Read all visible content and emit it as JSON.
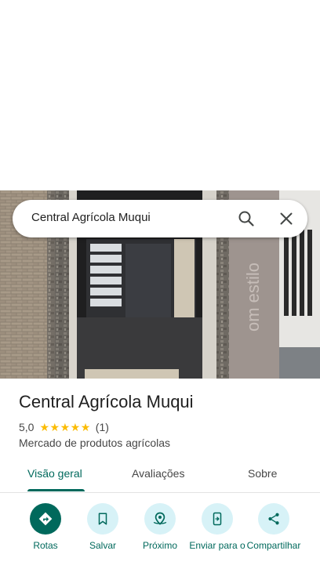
{
  "search": {
    "query": "Central Agrícola Muqui"
  },
  "place": {
    "name": "Central Agrícola Muqui",
    "rating": "5,0",
    "stars": [
      "★",
      "★",
      "★",
      "★",
      "★"
    ],
    "review_count": "(1)",
    "category": "Mercado de produtos agrícolas"
  },
  "tabs": [
    {
      "label": "Visão geral",
      "active": true
    },
    {
      "label": "Avaliações",
      "active": false
    },
    {
      "label": "Sobre",
      "active": false
    }
  ],
  "actions": [
    {
      "label": "Rotas",
      "icon": "directions-icon"
    },
    {
      "label": "Salvar",
      "icon": "bookmark-icon"
    },
    {
      "label": "Próximo",
      "icon": "nearby-icon"
    },
    {
      "label": "Enviar para o",
      "icon": "send-to-phone-icon"
    },
    {
      "label": "Compartilhar",
      "icon": "share-icon"
    }
  ],
  "photo": {
    "wall_text": "om estilo"
  },
  "colors": {
    "accent": "#00695c",
    "chip": "#d7f2f7",
    "star": "#fbbc04"
  }
}
